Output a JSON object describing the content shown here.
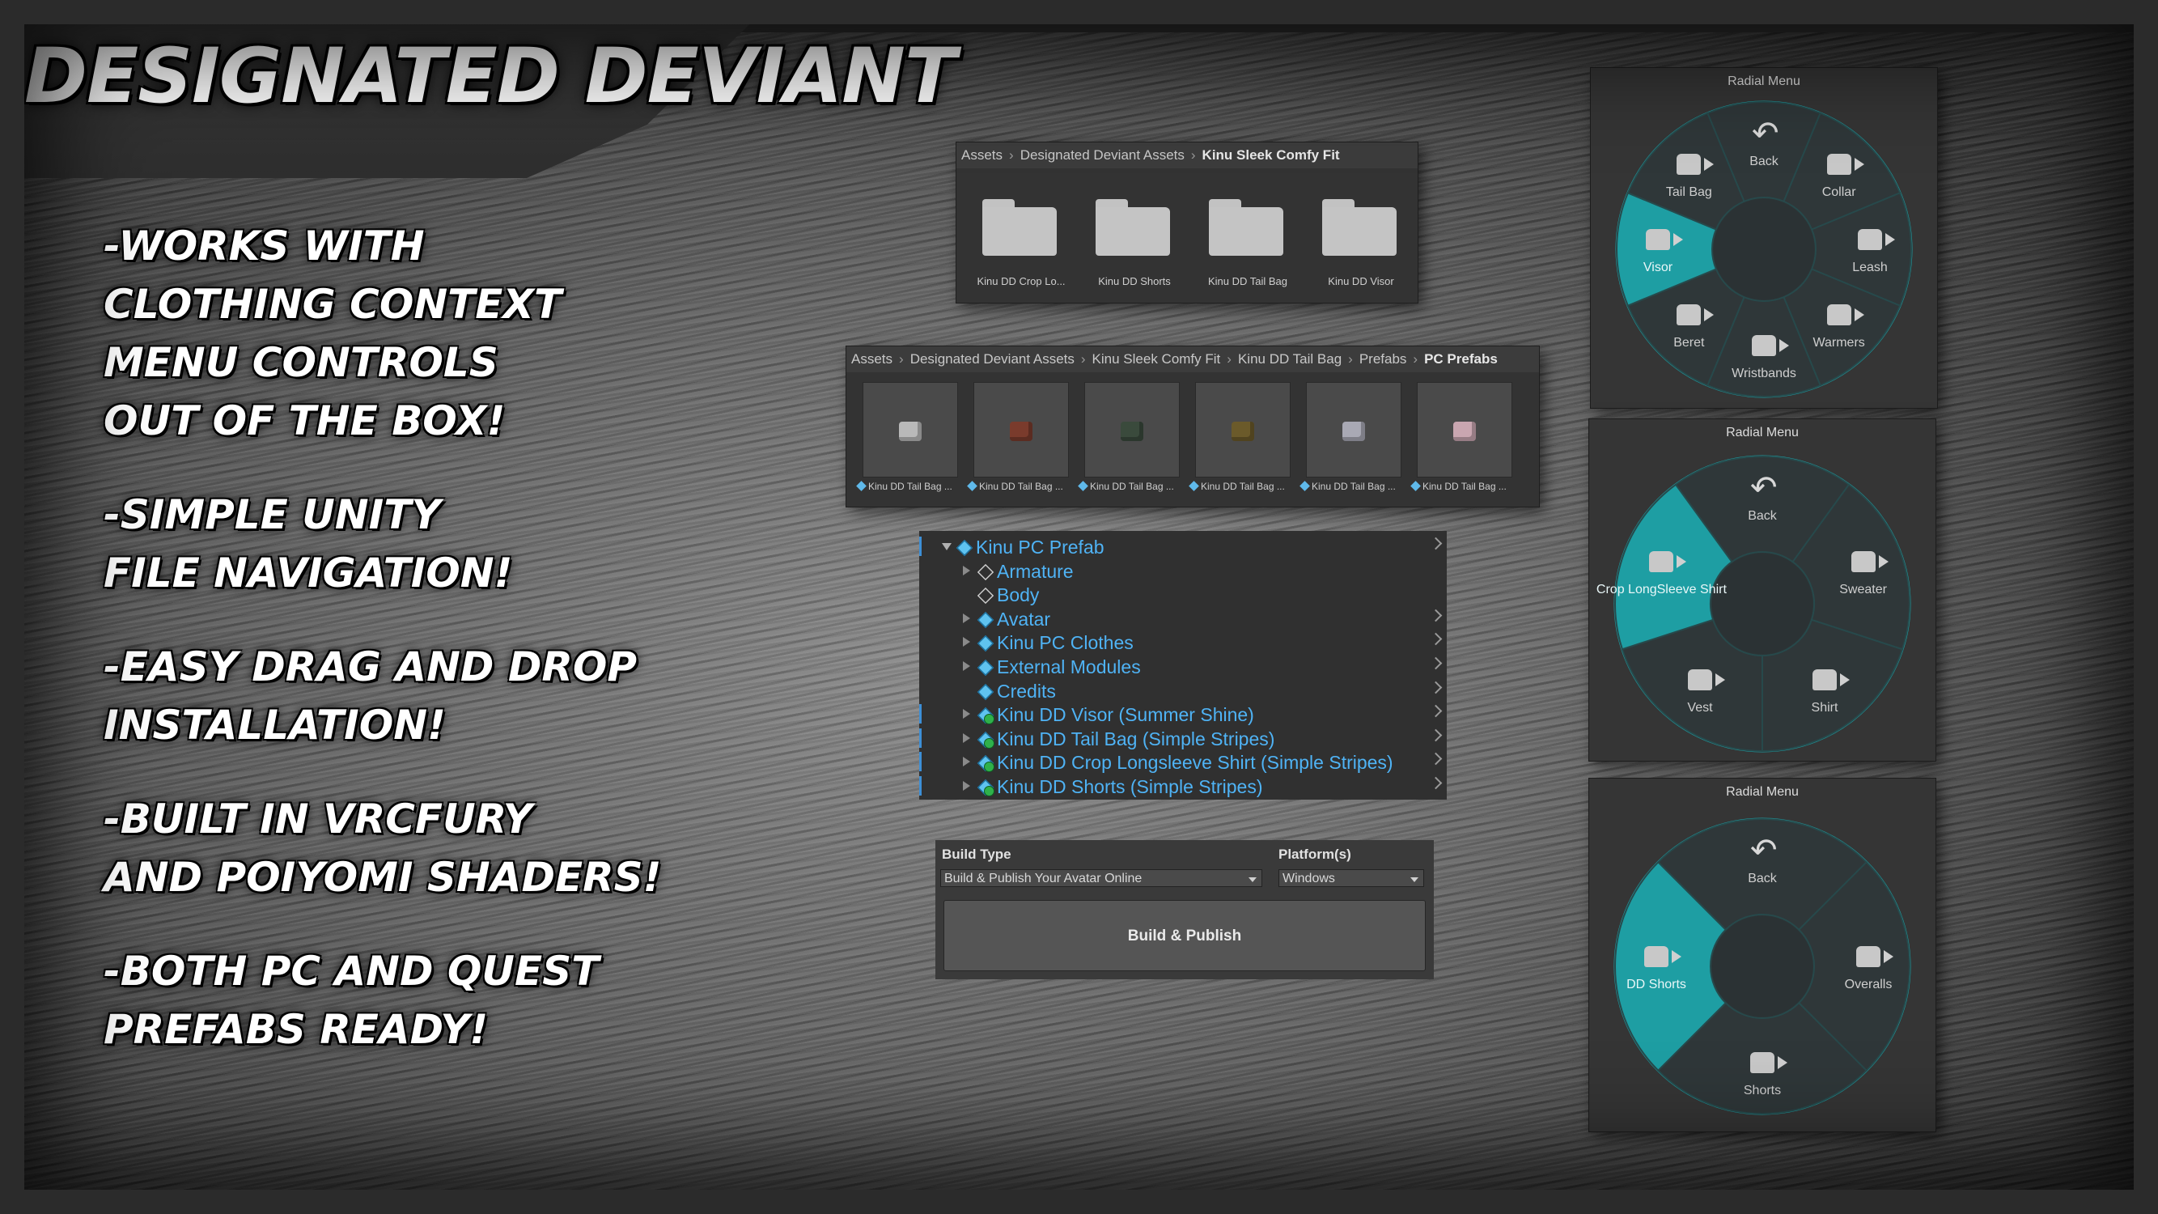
{
  "title": "DESIGNATED DEVIANT",
  "features": [
    {
      "lines": [
        "-WORKS WITH",
        "CLOTHING CONTEXT",
        "MENU CONTROLS",
        "OUT OF THE BOX!"
      ]
    },
    {
      "lines": [
        "-SIMPLE UNITY",
        "FILE NAVIGATION!"
      ]
    },
    {
      "lines": [
        "-EASY DRAG AND DROP",
        "INSTALLATION!"
      ]
    },
    {
      "lines": [
        "-BUILT IN VRCFURY",
        "AND POIYOMI SHADERS!"
      ]
    },
    {
      "lines": [
        "-BOTH PC AND QUEST",
        "PREFABS READY!"
      ]
    }
  ],
  "folder_panel": {
    "breadcrumb": [
      "Assets",
      "Designated Deviant Assets",
      "Kinu Sleek Comfy Fit"
    ],
    "folders": [
      "Kinu DD Crop Lo...",
      "Kinu DD Shorts",
      "Kinu DD Tail Bag",
      "Kinu DD Visor"
    ]
  },
  "prefab_panel": {
    "breadcrumb": [
      "Assets",
      "Designated Deviant Assets",
      "Kinu Sleek Comfy Fit",
      "Kinu DD Tail Bag",
      "Prefabs",
      "PC Prefabs"
    ],
    "items": [
      "Kinu DD Tail Bag ...",
      "Kinu DD Tail Bag ...",
      "Kinu DD Tail Bag ...",
      "Kinu DD Tail Bag ...",
      "Kinu DD Tail Bag ...",
      "Kinu DD Tail Bag ..."
    ],
    "thumb_colors": [
      "#b9b9b9",
      "#7a3b2c",
      "#3a4a3c",
      "#6b5a2a",
      "#a9a9b4",
      "#c9a6b0"
    ]
  },
  "hierarchy": {
    "rows": [
      {
        "label": "Kinu PC Prefab",
        "level": 0,
        "expanded": true,
        "icon": "prefab-cube-icon"
      },
      {
        "label": "Armature",
        "level": 1,
        "icon": "gameobject-icon"
      },
      {
        "label": "Body",
        "level": 1,
        "icon": "gameobject-icon"
      },
      {
        "label": "Avatar",
        "level": 1,
        "icon": "prefab-cube-icon"
      },
      {
        "label": "Kinu PC Clothes",
        "level": 1,
        "icon": "prefab-cube-icon"
      },
      {
        "label": "External Modules",
        "level": 1,
        "icon": "prefab-cube-icon"
      },
      {
        "label": "Credits",
        "level": 1,
        "icon": "prefab-cube-icon"
      },
      {
        "label": "Kinu DD Visor (Summer Shine)",
        "level": 1,
        "icon": "added-prefab-icon"
      },
      {
        "label": "Kinu DD Tail Bag (Simple Stripes)",
        "level": 1,
        "icon": "added-prefab-icon"
      },
      {
        "label": "Kinu DD Crop Longsleeve Shirt (Simple Stripes)",
        "level": 1,
        "icon": "added-prefab-icon"
      },
      {
        "label": "Kinu DD Shorts (Simple Stripes)",
        "level": 1,
        "icon": "added-prefab-icon"
      }
    ]
  },
  "build": {
    "build_type_label": "Build Type",
    "build_type_value": "Build & Publish Your Avatar Online",
    "platform_label": "Platform(s)",
    "platform_value": "Windows",
    "button_label": "Build & Publish"
  },
  "radial_menus": [
    {
      "title": "Radial Menu",
      "items": [
        "Back",
        "Collar",
        "Leash",
        "Warmers",
        "Wristbands",
        "Beret",
        "Visor",
        "Tail Bag"
      ],
      "selected": "Visor"
    },
    {
      "title": "Radial Menu",
      "items": [
        "Back",
        "Sweater",
        "Shirt",
        "Vest",
        "Crop LongSleeve Shirt"
      ],
      "selected": "Crop LongSleeve Shirt"
    },
    {
      "title": "Radial Menu",
      "items": [
        "Back",
        "Overalls",
        "Shorts",
        "DD Shorts"
      ],
      "selected": "DD Shorts"
    }
  ],
  "colors": {
    "accent": "#1e9ea3",
    "ring": "#2f3a3c",
    "hierarchy_text": "#4fb3f5"
  }
}
